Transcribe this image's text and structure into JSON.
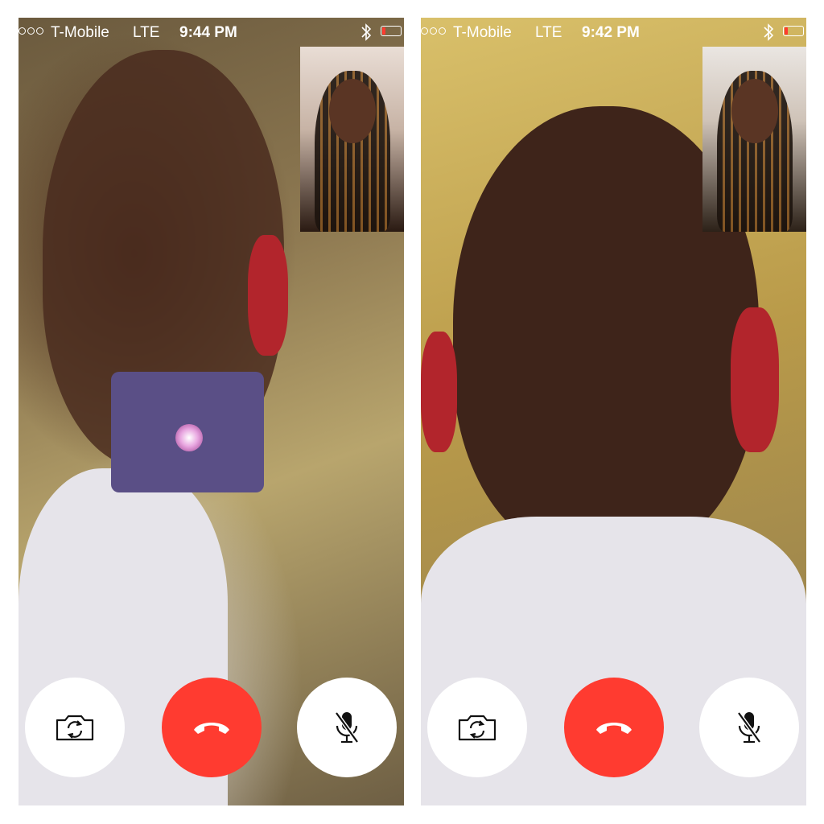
{
  "screens": [
    {
      "status": {
        "carrier": "T-Mobile",
        "network": "LTE",
        "time": "9:44 PM",
        "battery_color": "#ff3b30"
      },
      "icons": {
        "signal": "signal-dots-icon",
        "bluetooth": "bluetooth-icon",
        "battery": "battery-low-icon"
      },
      "controls": {
        "flip": "flip-camera-icon",
        "end": "end-call-icon",
        "mute": "mute-microphone-icon"
      }
    },
    {
      "status": {
        "carrier": "T-Mobile",
        "network": "LTE",
        "time": "9:42 PM",
        "battery_color": "#ff3b30"
      },
      "icons": {
        "signal": "signal-dots-icon",
        "bluetooth": "bluetooth-icon",
        "battery": "battery-low-icon"
      },
      "controls": {
        "flip": "flip-camera-icon",
        "end": "end-call-icon",
        "mute": "mute-microphone-icon"
      }
    }
  ],
  "colors": {
    "end_call": "#ff3b30",
    "control_bg": "#ffffff",
    "status_text": "#ffffff"
  }
}
